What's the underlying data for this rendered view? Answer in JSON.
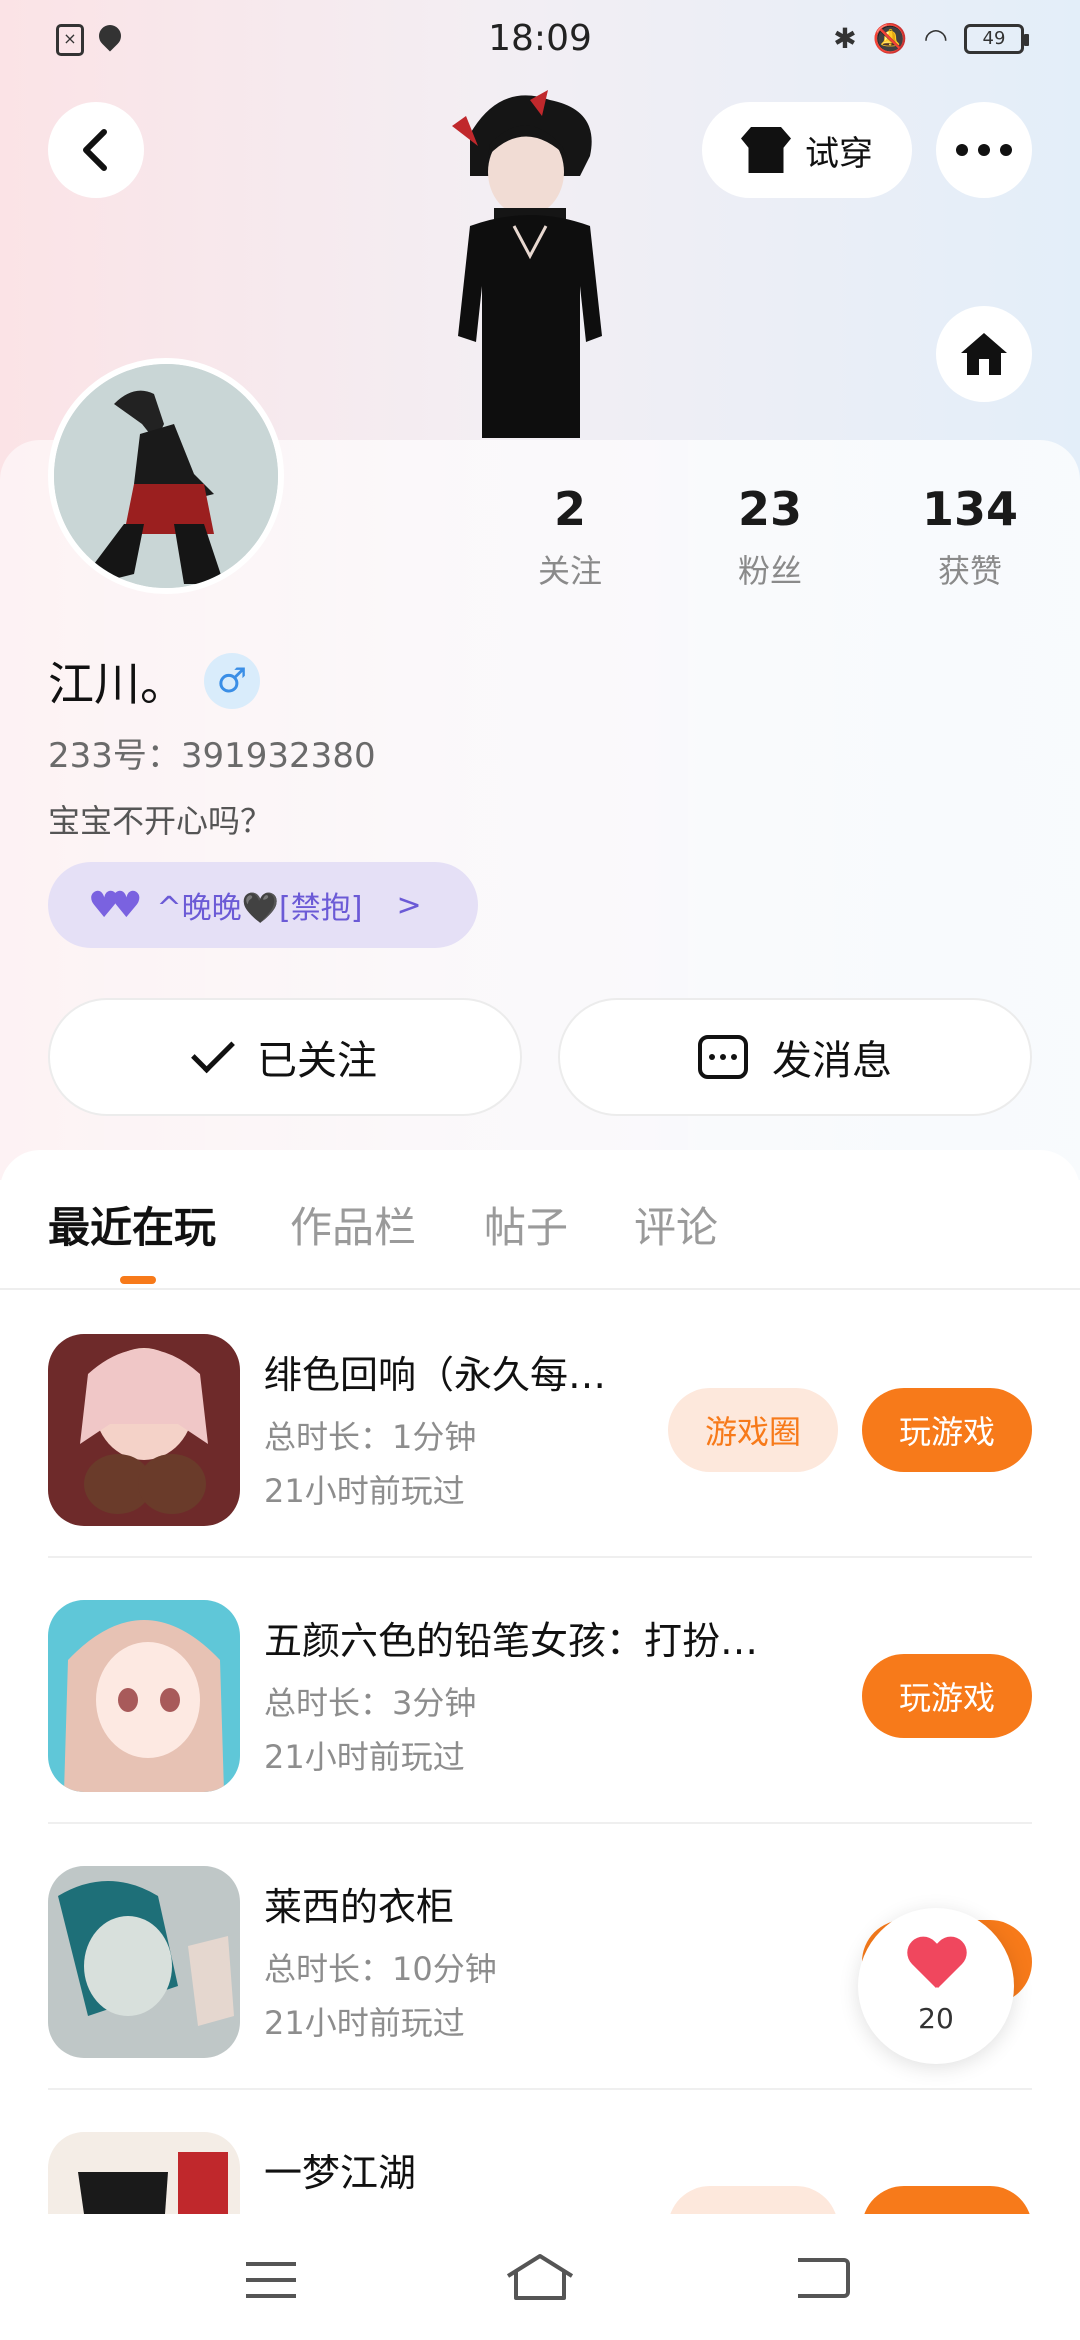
{
  "status_bar": {
    "time": "18:09",
    "battery": "49",
    "left_icons": [
      "screenshot-icon",
      "du-location-icon"
    ],
    "right_icons": [
      "bluetooth-icon",
      "mute-icon",
      "wifi-icon",
      "battery-icon"
    ]
  },
  "header": {
    "try_on_label": "试穿"
  },
  "profile": {
    "nickname": "江川。",
    "gender_symbol": "♂",
    "uid": "233号：391932380",
    "bio": "宝宝不开心吗？",
    "relation_chip": "^晚晚🖤[禁抱]",
    "stats": [
      {
        "value": "2",
        "label": "关注"
      },
      {
        "value": "23",
        "label": "粉丝"
      },
      {
        "value": "134",
        "label": "获赞"
      }
    ]
  },
  "actions": {
    "followed_label": "已关注",
    "message_label": "发消息"
  },
  "tabs": [
    "最近在玩",
    "作品栏",
    "帖子",
    "评论"
  ],
  "games": [
    {
      "title": "绯色回响（永久每…",
      "duration": "总时长：1分钟",
      "last_played": "21小时前玩过",
      "circle_label": "游戏圈",
      "play_label": "玩游戏"
    },
    {
      "title": "五颜六色的铅笔女孩：打扮…",
      "duration": "总时长：3分钟",
      "last_played": "21小时前玩过",
      "play_label": "玩游戏"
    },
    {
      "title": "莱西的衣柜",
      "duration": "总时长：10分钟",
      "last_played": "21小时前玩过"
    },
    {
      "title": "一梦江湖"
    }
  ],
  "floating_like": {
    "count": "20"
  },
  "colors": {
    "accent": "#f77a1a",
    "accent_light": "#fde8dc",
    "chip_bg": "#e5e0f6",
    "chip_text": "#6b5ad6",
    "like_heart": "#f0475e"
  }
}
